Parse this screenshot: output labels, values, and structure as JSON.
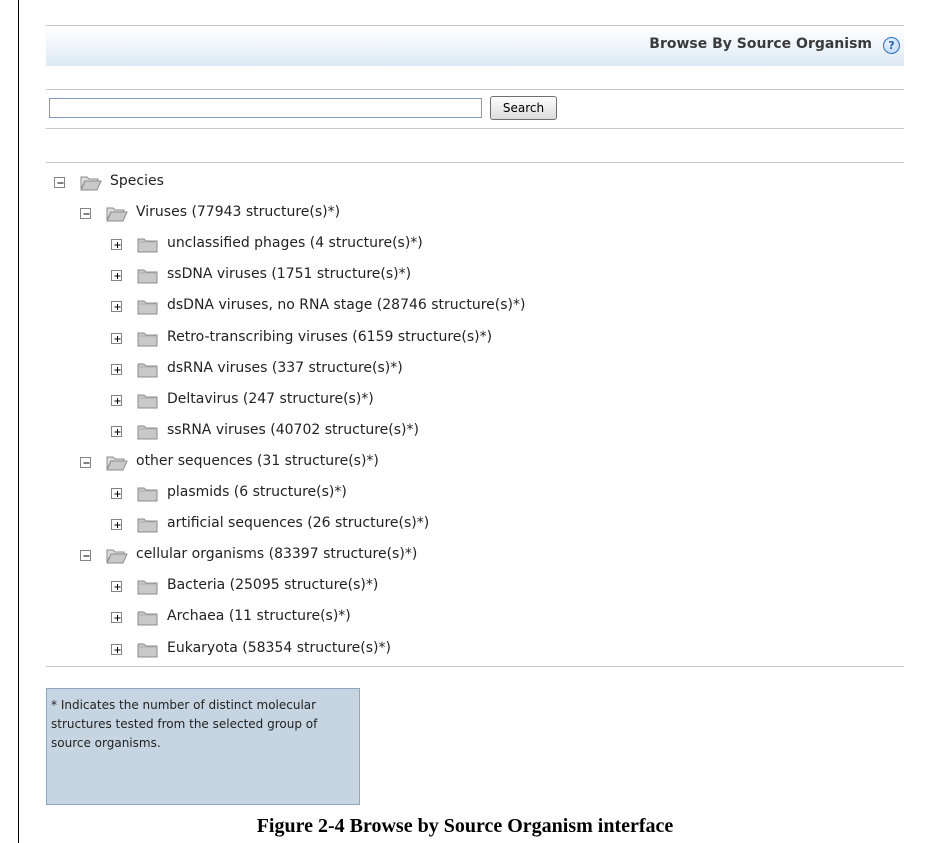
{
  "header": {
    "title": "Browse By Source Organism",
    "help_icon": "question-mark-icon",
    "help_glyph": "?"
  },
  "search": {
    "value": "",
    "placeholder": "",
    "button_label": "Search"
  },
  "tree": [
    {
      "label": "Species",
      "level": 0,
      "expanded": true
    },
    {
      "label": "Viruses (77943 structure(s)*)",
      "level": 1,
      "expanded": true
    },
    {
      "label": "unclassified phages (4 structure(s)*)",
      "level": 2,
      "expanded": false
    },
    {
      "label": "ssDNA viruses (1751 structure(s)*)",
      "level": 2,
      "expanded": false
    },
    {
      "label": "dsDNA viruses, no RNA stage (28746 structure(s)*)",
      "level": 2,
      "expanded": false
    },
    {
      "label": "Retro-transcribing viruses (6159 structure(s)*)",
      "level": 2,
      "expanded": false
    },
    {
      "label": "dsRNA viruses (337 structure(s)*)",
      "level": 2,
      "expanded": false
    },
    {
      "label": "Deltavirus (247 structure(s)*)",
      "level": 2,
      "expanded": false
    },
    {
      "label": "ssRNA viruses (40702 structure(s)*)",
      "level": 2,
      "expanded": false
    },
    {
      "label": "other sequences (31 structure(s)*)",
      "level": 1,
      "expanded": true
    },
    {
      "label": "plasmids (6 structure(s)*)",
      "level": 2,
      "expanded": false
    },
    {
      "label": "artificial sequences (26 structure(s)*)",
      "level": 2,
      "expanded": false
    },
    {
      "label": "cellular organisms (83397 structure(s)*)",
      "level": 1,
      "expanded": true
    },
    {
      "label": "Bacteria (25095 structure(s)*)",
      "level": 2,
      "expanded": false
    },
    {
      "label": "Archaea (11 structure(s)*)",
      "level": 2,
      "expanded": false
    },
    {
      "label": "Eukaryota (58354 structure(s)*)",
      "level": 2,
      "expanded": false
    }
  ],
  "note": {
    "text": "* Indicates the number of distinct molecular structures tested from the selected group of source organisms."
  },
  "caption": "Figure 2-4  Browse by Source Organism interface",
  "colors": {
    "header_gradient_end": "#dbe8f5",
    "note_background": "#c7d5e2",
    "folder": "#c9c9c9"
  }
}
